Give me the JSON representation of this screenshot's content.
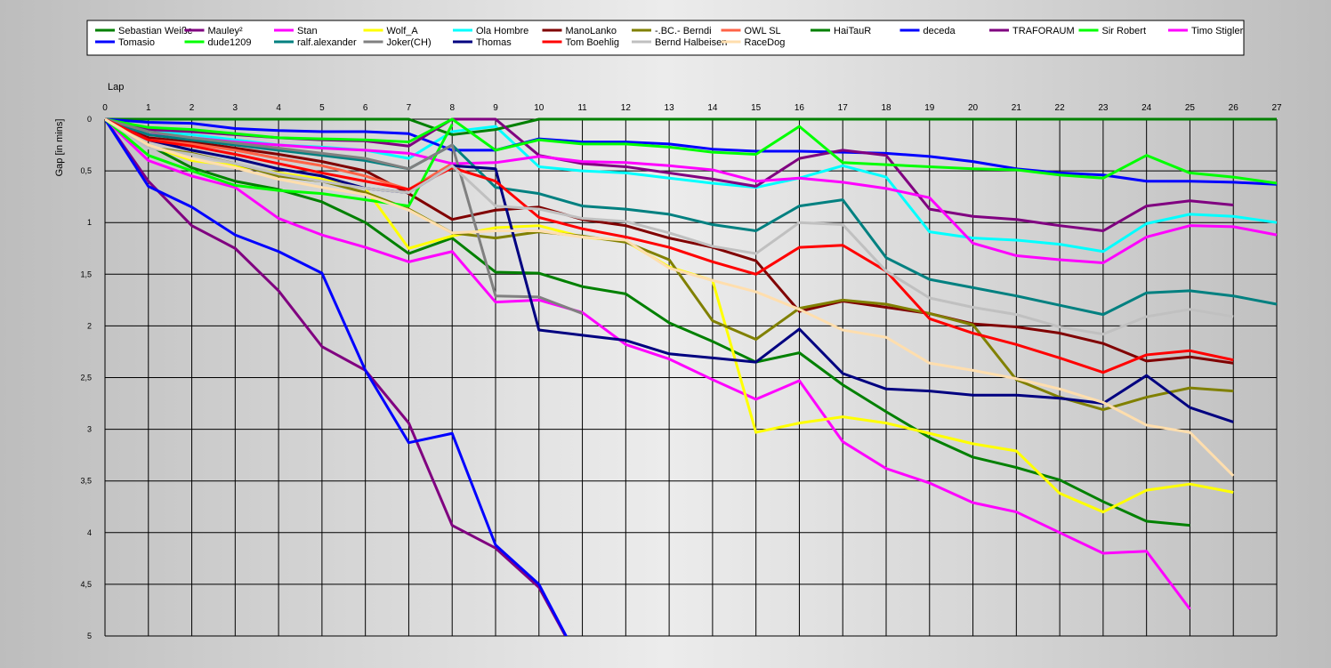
{
  "chart_data": {
    "type": "line",
    "xlabel": "Lap",
    "ylabel": "Gap [in mins]",
    "xlim": [
      0,
      27
    ],
    "ylim": [
      0,
      5
    ],
    "y_inverted": true,
    "grid": true,
    "legend_position": "top",
    "x_ticks": [
      "0",
      "1",
      "2",
      "3",
      "4",
      "5",
      "6",
      "7",
      "8",
      "9",
      "10",
      "11",
      "12",
      "13",
      "14",
      "15",
      "16",
      "17",
      "18",
      "19",
      "20",
      "21",
      "22",
      "23",
      "24",
      "25",
      "26",
      "27"
    ],
    "y_ticks": [
      "0",
      "0,5",
      "1",
      "1,5",
      "2",
      "2,5",
      "3",
      "3,5",
      "4",
      "4,5",
      "5"
    ],
    "legend_rows": [
      [
        "Sebastian Weiße",
        "Mauley²",
        "Stan",
        "Wolf_A",
        "Ola Hombre",
        "ManoLanko",
        "-.BC.- Berndi",
        "OWL SL",
        "HaiTauR",
        "deceda",
        "TRAFORAUM",
        "Sir Robert",
        "Timo Stigler"
      ],
      [
        "Tomasio",
        "dude1209",
        "ralf.alexander",
        "Joker(CH)",
        "Thomas",
        "Tom Boehlig",
        "Bernd Halbeisen",
        "RaceDog"
      ]
    ],
    "series": [
      {
        "name": "Sebastian Weiße",
        "color": "#008000",
        "values": [
          0,
          0.25,
          0.47,
          0.6,
          0.68,
          0.8,
          1.0,
          1.3,
          1.15,
          1.48,
          1.49,
          1.62,
          1.69,
          1.97,
          2.15,
          2.35,
          2.26,
          2.57,
          2.83,
          3.08,
          3.27,
          3.37,
          3.49,
          3.7,
          3.89,
          3.93
        ]
      },
      {
        "name": "Mauley²",
        "color": "#800080",
        "values": [
          0,
          0.6,
          1.03,
          1.25,
          1.66,
          2.2,
          2.43,
          2.94,
          3.93,
          4.15,
          4.53,
          5.3
        ]
      },
      {
        "name": "Stan",
        "color": "#ff00ff",
        "values": [
          0,
          0.4,
          0.55,
          0.66,
          0.96,
          1.12,
          1.24,
          1.38,
          1.28,
          1.77,
          1.75,
          1.87,
          2.18,
          2.32,
          2.52,
          2.71,
          2.53,
          3.12,
          3.38,
          3.52,
          3.71,
          3.8,
          4.0,
          4.2,
          4.18,
          4.74
        ]
      },
      {
        "name": "Wolf_A",
        "color": "#ffff00",
        "values": [
          0,
          0.25,
          0.4,
          0.45,
          0.52,
          0.58,
          0.67,
          1.25,
          1.13,
          1.05,
          1.03,
          1.14,
          1.18,
          1.43,
          1.56,
          3.03,
          2.94,
          2.88,
          2.94,
          3.04,
          3.14,
          3.21,
          3.62,
          3.8,
          3.59,
          3.53,
          3.61
        ]
      },
      {
        "name": "Ola Hombre",
        "color": "#00ffff",
        "values": [
          0,
          0.12,
          0.15,
          0.2,
          0.25,
          0.27,
          0.3,
          0.38,
          0.12,
          0.07,
          0.46,
          0.5,
          0.52,
          0.57,
          0.62,
          0.66,
          0.57,
          0.45,
          0.56,
          1.09,
          1.15,
          1.17,
          1.21,
          1.28,
          1.01,
          0.92,
          0.94,
          1.0
        ]
      },
      {
        "name": "ManoLanko",
        "color": "#800000",
        "values": [
          0,
          0.18,
          0.22,
          0.28,
          0.34,
          0.41,
          0.5,
          0.72,
          0.97,
          0.88,
          0.85,
          0.97,
          1.03,
          1.15,
          1.24,
          1.37,
          1.86,
          1.76,
          1.82,
          1.88,
          1.98,
          2.01,
          2.07,
          2.17,
          2.34,
          2.3,
          2.36
        ]
      },
      {
        "name": "-.BC.- Berndi",
        "color": "#808000",
        "values": [
          0,
          0.27,
          0.33,
          0.43,
          0.55,
          0.6,
          0.71,
          0.87,
          1.1,
          1.15,
          1.09,
          1.13,
          1.19,
          1.36,
          1.95,
          2.13,
          1.83,
          1.75,
          1.79,
          1.88,
          1.99,
          2.52,
          2.69,
          2.81,
          2.69,
          2.6,
          2.63
        ]
      },
      {
        "name": "OWL SL",
        "color": "#ff6347",
        "values": [
          0,
          0.2,
          0.24,
          0.3,
          0.38,
          0.45,
          0.55,
          0.68,
          0.43
        ]
      },
      {
        "name": "HaiTauR",
        "color": "#008000",
        "values": [
          0,
          0,
          0,
          0,
          0,
          0,
          0,
          0,
          0.15,
          0.1,
          0,
          0,
          0,
          0,
          0,
          0,
          0,
          0,
          0,
          0,
          0,
          0,
          0,
          0,
          0,
          0,
          0,
          0
        ]
      },
      {
        "name": "deceda",
        "color": "#0000ff",
        "values": [
          0,
          0.03,
          0.04,
          0.09,
          0.11,
          0.12,
          0.12,
          0.14,
          0.3,
          0.3,
          0.19,
          0.22,
          0.22,
          0.24,
          0.29,
          0.31,
          0.31,
          0.32,
          0.33,
          0.36,
          0.41,
          0.48,
          0.52,
          0.54,
          0.6,
          0.6,
          0.61,
          0.63
        ]
      },
      {
        "name": "TRAFORAUM",
        "color": "#800080",
        "values": [
          0,
          0.1,
          0.12,
          0.15,
          0.18,
          0.2,
          0.21,
          0.26,
          0,
          0,
          0.35,
          0.43,
          0.46,
          0.52,
          0.58,
          0.65,
          0.38,
          0.3,
          0.35,
          0.87,
          0.94,
          0.97,
          1.03,
          1.08,
          0.84,
          0.79,
          0.83
        ]
      },
      {
        "name": "Sir Robert",
        "color": "#00ff00",
        "values": [
          0,
          0.08,
          0.1,
          0.14,
          0.18,
          0.19,
          0.2,
          0.22,
          0,
          0.3,
          0.2,
          0.24,
          0.24,
          0.27,
          0.32,
          0.34,
          0.07,
          0.42,
          0.44,
          0.46,
          0.48,
          0.49,
          0.54,
          0.57,
          0.35,
          0.52,
          0.56,
          0.62
        ]
      },
      {
        "name": "Timo Stigler",
        "color": "#ff00ff",
        "values": [
          0,
          0.15,
          0.18,
          0.22,
          0.25,
          0.28,
          0.3,
          0.33,
          0.43,
          0.42,
          0.36,
          0.41,
          0.42,
          0.45,
          0.49,
          0.6,
          0.57,
          0.61,
          0.67,
          0.76,
          1.2,
          1.32,
          1.36,
          1.39,
          1.14,
          1.03,
          1.04,
          1.12
        ]
      },
      {
        "name": "Tomasio",
        "color": "#0000ff",
        "values": [
          0,
          0.65,
          0.85,
          1.12,
          1.28,
          1.49,
          2.43,
          3.13,
          3.04,
          4.12,
          4.5,
          5.3
        ]
      },
      {
        "name": "dude1209",
        "color": "#00ff00",
        "values": [
          0,
          0.35,
          0.5,
          0.64,
          0.69,
          0.72,
          0.78,
          0.84,
          0.05
        ]
      },
      {
        "name": "ralf.alexander",
        "color": "#008080",
        "values": [
          0,
          0.15,
          0.2,
          0.25,
          0.3,
          0.35,
          0.4,
          0.48,
          0.25,
          0.66,
          0.72,
          0.84,
          0.87,
          0.92,
          1.02,
          1.08,
          0.84,
          0.78,
          1.34,
          1.55,
          1.63,
          1.71,
          1.8,
          1.89,
          1.68,
          1.66,
          1.71,
          1.79
        ]
      },
      {
        "name": "Joker(CH)",
        "color": "#808080",
        "values": [
          0,
          0.12,
          0.18,
          0.23,
          0.28,
          0.33,
          0.38,
          0.48,
          0.25,
          1.71,
          1.72,
          1.88
        ]
      },
      {
        "name": "Thomas",
        "color": "#000080",
        "values": [
          0,
          0.2,
          0.3,
          0.38,
          0.48,
          0.55,
          0.67,
          0.71,
          0.45,
          0.48,
          2.04,
          2.09,
          2.14,
          2.27,
          2.31,
          2.35,
          2.03,
          2.46,
          2.61,
          2.63,
          2.67,
          2.67,
          2.7,
          2.75,
          2.48,
          2.79,
          2.93
        ]
      },
      {
        "name": "Tom Boehlig",
        "color": "#ff0000",
        "values": [
          0,
          0.2,
          0.26,
          0.34,
          0.43,
          0.52,
          0.6,
          0.68,
          0.47,
          0.6,
          0.95,
          1.06,
          1.14,
          1.24,
          1.38,
          1.5,
          1.24,
          1.22,
          1.47,
          1.93,
          2.07,
          2.18,
          2.31,
          2.45,
          2.28,
          2.24,
          2.33
        ]
      },
      {
        "name": "Bernd Halbeisen",
        "color": "#c0c0c0",
        "values": [
          0,
          0.28,
          0.34,
          0.43,
          0.53,
          0.6,
          0.67,
          0.71,
          0.45,
          0.84,
          0.87,
          0.96,
          0.99,
          1.1,
          1.23,
          1.3,
          1.0,
          1.02,
          1.47,
          1.73,
          1.82,
          1.89,
          2.01,
          2.08,
          1.91,
          1.84,
          1.91
        ]
      },
      {
        "name": "RaceDog",
        "color": "#ffdead",
        "values": [
          0,
          0.25,
          0.38,
          0.47,
          0.58,
          0.66,
          0.73,
          0.88,
          1.1,
          1.08,
          1.08,
          1.14,
          1.17,
          1.44,
          1.56,
          1.67,
          1.84,
          2.04,
          2.11,
          2.36,
          2.43,
          2.51,
          2.61,
          2.74,
          2.96,
          3.03,
          3.45
        ]
      }
    ]
  }
}
